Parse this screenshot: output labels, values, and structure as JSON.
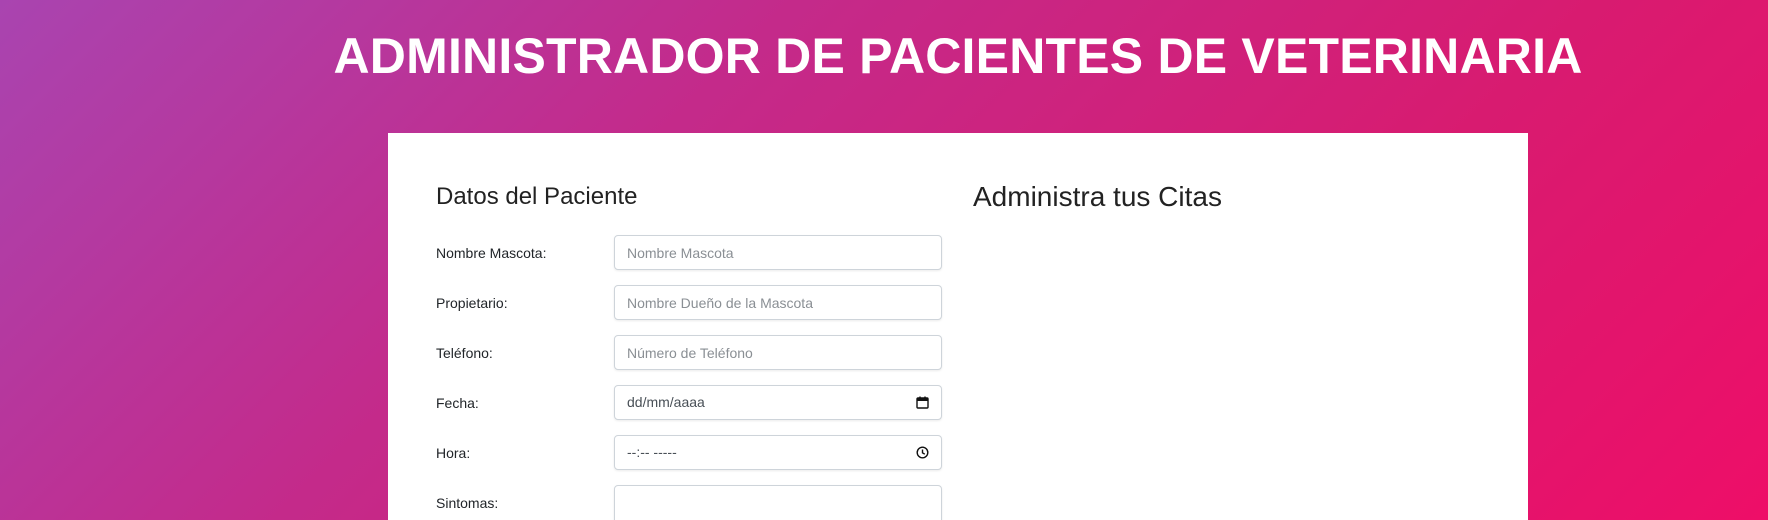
{
  "header": {
    "title": "ADMINISTRADOR DE PACIENTES DE VETERINARIA"
  },
  "form": {
    "title": "Datos del Paciente",
    "fields": [
      {
        "label": "Nombre Mascota:",
        "placeholder": "Nombre Mascota",
        "value": ""
      },
      {
        "label": "Propietario:",
        "placeholder": "Nombre Dueño de la Mascota",
        "value": ""
      },
      {
        "label": "Teléfono:",
        "placeholder": "Número de Teléfono",
        "value": ""
      },
      {
        "label": "Fecha:",
        "display": "dd/mm/aaaa",
        "icon": "calendar-icon"
      },
      {
        "label": "Hora:",
        "display": "--:-- -----",
        "icon": "clock-icon"
      },
      {
        "label": "Sintomas:",
        "value": ""
      }
    ]
  },
  "appointments": {
    "title": "Administra tus Citas"
  }
}
